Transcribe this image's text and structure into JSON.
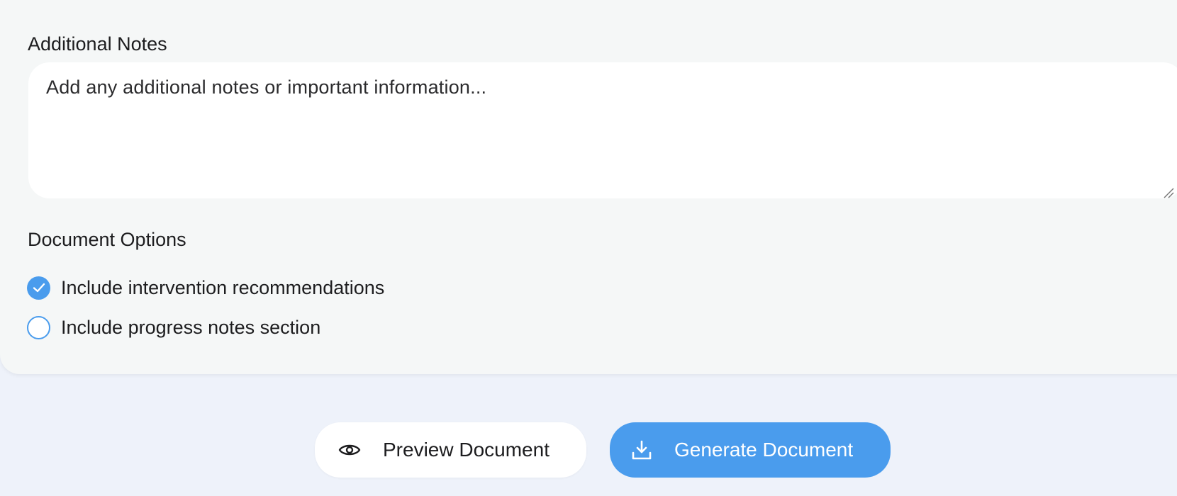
{
  "notes": {
    "label": "Additional Notes",
    "placeholder": "Add any additional notes or important information..."
  },
  "options": {
    "label": "Document Options",
    "items": [
      {
        "label": "Include intervention recommendations",
        "checked": true
      },
      {
        "label": "Include progress notes section",
        "checked": false
      }
    ]
  },
  "actions": {
    "preview_label": "Preview Document",
    "preview_icon": "eye-icon",
    "generate_label": "Generate Document",
    "generate_icon": "download-icon"
  },
  "colors": {
    "accent": "#4a9ced",
    "card_background": "#f5f7f7",
    "page_background": "#eef2fa"
  }
}
